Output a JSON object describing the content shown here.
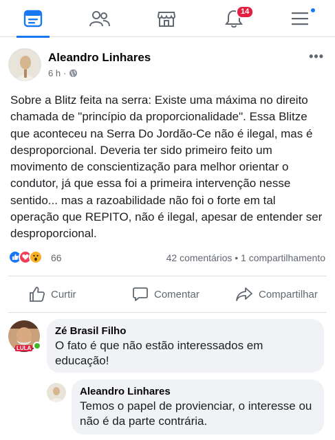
{
  "nav": {
    "notifications_badge": "14"
  },
  "post": {
    "author": "Aleandro Linhares",
    "time": "6 h",
    "text": "Sobre a Blitz feita na serra: Existe uma máxima no direito chamada de \"princípio da proporcionalidade\". Essa Blitze que aconteceu na Serra Do Jordão-Ce não é ilegal, mas é desproporcional. Deveria ter sido primeiro feito um movimento de conscientização para melhor orientar o condutor, já que essa foi a primeira intervenção nesse sentido... mas a razoabilidade não foi o forte em tal operação que REPITO, não é ilegal, apesar de entender ser desproporcional.",
    "reaction_count": "66",
    "engagement": "42 comentários • 1 compartilhamento"
  },
  "actions": {
    "like": "Curtir",
    "comment": "Comentar",
    "share": "Compartilhar"
  },
  "comments": [
    {
      "author": "Zé Brasil Filho",
      "text": "O fato é que não estão interessados em educação!",
      "avatar_tag": "LULA"
    },
    {
      "author": "Aleandro Linhares",
      "text": "Temos o papel de provienciar, o interesse ou não é da parte contrária."
    }
  ],
  "colors": {
    "brand_blue": "#1877f2",
    "badge_red": "#e41e3f",
    "bubble_gray": "#f0f2f5",
    "online_green": "#42b72a"
  },
  "icons": [
    "feed-icon",
    "friends-icon",
    "marketplace-icon",
    "bell-icon",
    "menu-icon",
    "globe-icon",
    "more-icon",
    "like-icon",
    "love-icon",
    "wow-icon",
    "thumbs-up-icon",
    "comment-icon",
    "share-icon"
  ]
}
